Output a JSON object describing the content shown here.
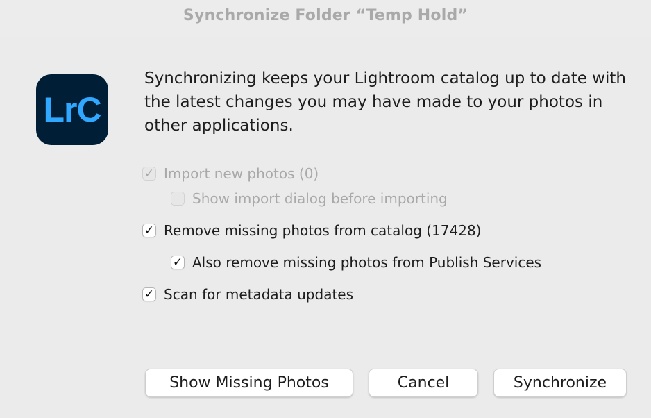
{
  "dialog": {
    "title": "Synchronize Folder “Temp Hold”",
    "app_icon_text": "LrC",
    "message": "Synchronizing keeps your Lightroom catalog up to date with the latest changes you may have made to your photos in other applications."
  },
  "options": {
    "import_new": {
      "label": "Import new photos (0)",
      "checked": true,
      "enabled": false
    },
    "show_import_dialog": {
      "label": "Show import dialog before importing",
      "checked": false,
      "enabled": false
    },
    "remove_missing": {
      "label": "Remove missing photos from catalog (17428)",
      "checked": true,
      "enabled": true
    },
    "remove_from_publish": {
      "label": "Also remove missing photos from Publish Services",
      "checked": true,
      "enabled": true
    },
    "scan_metadata": {
      "label": "Scan for metadata updates",
      "checked": true,
      "enabled": true
    }
  },
  "buttons": {
    "show_missing": "Show Missing Photos",
    "cancel": "Cancel",
    "synchronize": "Synchronize"
  },
  "colors": {
    "background": "#ebebeb",
    "icon_bg": "#001e36",
    "icon_text": "#31a8ff",
    "disabled_text": "#a9a9a9"
  }
}
